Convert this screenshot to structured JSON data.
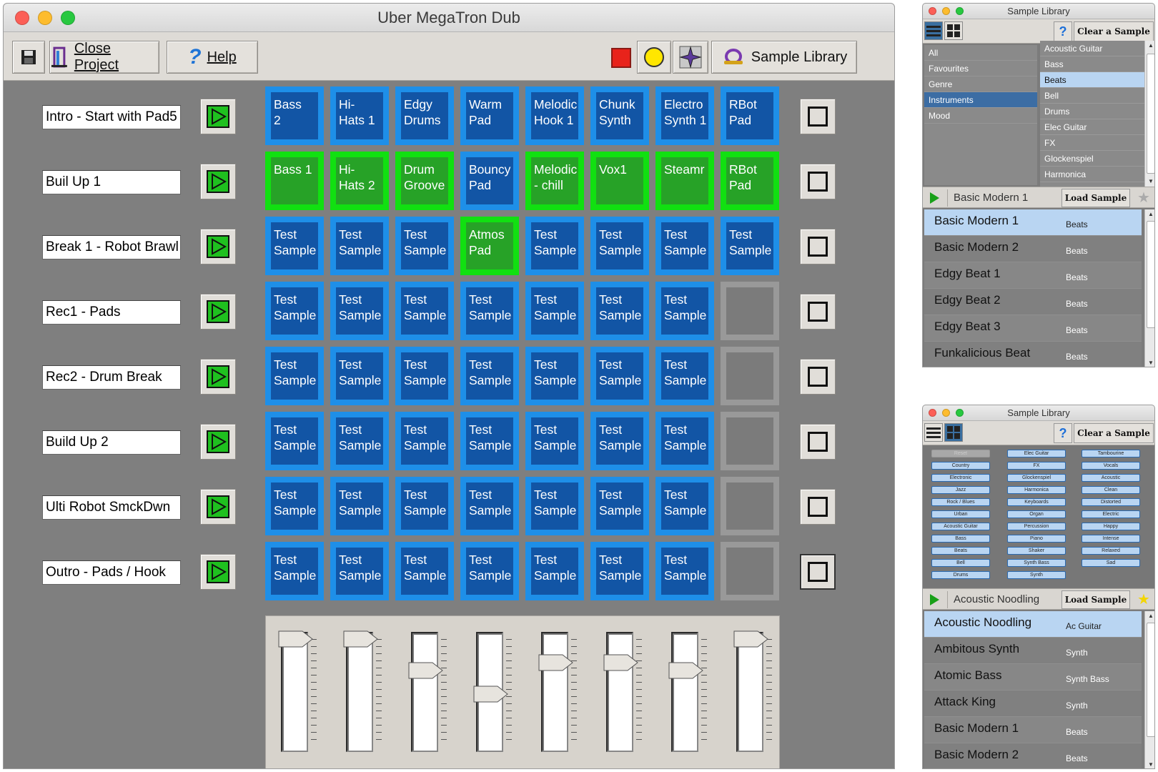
{
  "app": {
    "title": "Uber MegaTron Dub",
    "toolbar": {
      "close_project": "Close Project",
      "help": "Help",
      "sample_library": "Sample Library"
    }
  },
  "scenes": [
    {
      "name": "Intro - Start with Pad5"
    },
    {
      "name": "Buil Up 1"
    },
    {
      "name": "Break 1 - Robot Brawl"
    },
    {
      "name": "Rec1 - Pads"
    },
    {
      "name": "Rec2 - Drum Break"
    },
    {
      "name": "Build Up 2"
    },
    {
      "name": "Ulti Robot SmckDwn"
    },
    {
      "name": "Outro - Pads / Hook"
    }
  ],
  "pads": [
    [
      {
        "t": "Bass\n2",
        "s": "blue"
      },
      {
        "t": "Hi-\nHats 1",
        "s": "blue"
      },
      {
        "t": "Edgy\nDrums",
        "s": "blue"
      },
      {
        "t": "Warm\nPad",
        "s": "blue"
      },
      {
        "t": "Melodic\nHook 1",
        "s": "blue"
      },
      {
        "t": "Chunk\nSynth",
        "s": "blue"
      },
      {
        "t": "Electro\nSynth 1",
        "s": "blue"
      },
      {
        "t": "RBot\nPad",
        "s": "blue"
      }
    ],
    [
      {
        "t": "Bass 1",
        "s": "green"
      },
      {
        "t": "Hi-\nHats 2",
        "s": "green"
      },
      {
        "t": "Drum\nGroove",
        "s": "green"
      },
      {
        "t": "Bouncy\nPad",
        "s": "blue"
      },
      {
        "t": "Melodic\n- chill",
        "s": "green"
      },
      {
        "t": "Vox1",
        "s": "green"
      },
      {
        "t": "Steamr",
        "s": "green"
      },
      {
        "t": "RBot\nPad",
        "s": "green"
      }
    ],
    [
      {
        "t": "Test\nSample",
        "s": "blue"
      },
      {
        "t": "Test\nSample",
        "s": "blue"
      },
      {
        "t": "Test\nSample",
        "s": "blue"
      },
      {
        "t": "Atmos\nPad",
        "s": "green"
      },
      {
        "t": "Test\nSample",
        "s": "blue"
      },
      {
        "t": "Test\nSample",
        "s": "blue"
      },
      {
        "t": "Test\nSample",
        "s": "blue"
      },
      {
        "t": "Test\nSample",
        "s": "blue"
      }
    ],
    [
      {
        "t": "Test\nSample",
        "s": "blue"
      },
      {
        "t": "Test\nSample",
        "s": "blue"
      },
      {
        "t": "Test\nSample",
        "s": "blue"
      },
      {
        "t": "Test\nSample",
        "s": "blue"
      },
      {
        "t": "Test\nSample",
        "s": "blue"
      },
      {
        "t": "Test\nSample",
        "s": "blue"
      },
      {
        "t": "Test\nSample",
        "s": "blue"
      },
      {
        "t": "",
        "s": "empty"
      }
    ],
    [
      {
        "t": "Test\nSample",
        "s": "blue"
      },
      {
        "t": "Test\nSample",
        "s": "blue"
      },
      {
        "t": "Test\nSample",
        "s": "blue"
      },
      {
        "t": "Test\nSample",
        "s": "blue"
      },
      {
        "t": "Test\nSample",
        "s": "blue"
      },
      {
        "t": "Test\nSample",
        "s": "blue"
      },
      {
        "t": "Test\nSample",
        "s": "blue"
      },
      {
        "t": "",
        "s": "empty"
      }
    ],
    [
      {
        "t": "Test\nSample",
        "s": "blue"
      },
      {
        "t": "Test\nSample",
        "s": "blue"
      },
      {
        "t": "Test\nSample",
        "s": "blue"
      },
      {
        "t": "Test\nSample",
        "s": "blue"
      },
      {
        "t": "Test\nSample",
        "s": "blue"
      },
      {
        "t": "Test\nSample",
        "s": "blue"
      },
      {
        "t": "Test\nSample",
        "s": "blue"
      },
      {
        "t": "",
        "s": "empty"
      }
    ],
    [
      {
        "t": "Test\nSample",
        "s": "blue"
      },
      {
        "t": "Test\nSample",
        "s": "blue"
      },
      {
        "t": "Test\nSample",
        "s": "blue"
      },
      {
        "t": "Test\nSample",
        "s": "blue"
      },
      {
        "t": "Test\nSample",
        "s": "blue"
      },
      {
        "t": "Test\nSample",
        "s": "blue"
      },
      {
        "t": "Test\nSample",
        "s": "blue"
      },
      {
        "t": "",
        "s": "empty"
      }
    ],
    [
      {
        "t": "Test\nSample",
        "s": "blue"
      },
      {
        "t": "Test\nSample",
        "s": "blue"
      },
      {
        "t": "Test\nSample",
        "s": "blue"
      },
      {
        "t": "Test\nSample",
        "s": "blue"
      },
      {
        "t": "Test\nSample",
        "s": "blue"
      },
      {
        "t": "Test\nSample",
        "s": "blue"
      },
      {
        "t": "Test\nSample",
        "s": "blue"
      },
      {
        "t": "",
        "s": "empty"
      }
    ]
  ],
  "faders": {
    "levels": [
      1.0,
      1.0,
      0.7,
      0.48,
      0.78,
      0.78,
      0.7,
      1.0
    ]
  },
  "colors": {
    "pad_blue": "#1e8fe8",
    "pad_green": "#11e011",
    "stop_red": "#e8231b",
    "record_yellow": "#ffe600"
  },
  "library_list": {
    "title": "Sample Library",
    "clear_label": "Clear a Sample",
    "categories": [
      {
        "label": "All"
      },
      {
        "label": "Favourites"
      },
      {
        "label": "Genre"
      },
      {
        "label": "Instruments",
        "sel": true
      },
      {
        "label": "Mood"
      }
    ],
    "subcategories": [
      {
        "label": "Acoustic Guitar"
      },
      {
        "label": "Bass"
      },
      {
        "label": "Beats",
        "sel": true
      },
      {
        "label": "Bell"
      },
      {
        "label": "Drums"
      },
      {
        "label": "Elec Guitar"
      },
      {
        "label": "FX"
      },
      {
        "label": "Glockenspiel"
      },
      {
        "label": "Harmonica"
      }
    ],
    "current_sample": "Basic Modern 1",
    "load_label": "Load Sample",
    "samples": [
      {
        "name": "Basic Modern 1",
        "type": "Beats",
        "sel": true
      },
      {
        "name": "Basic Modern 2",
        "type": "Beats"
      },
      {
        "name": "Edgy Beat 1",
        "type": "Beats"
      },
      {
        "name": "Edgy Beat 2",
        "type": "Beats"
      },
      {
        "name": "Edgy Beat 3",
        "type": "Beats"
      },
      {
        "name": "Funkalicious Beat",
        "type": "Beats"
      }
    ]
  },
  "library_tags": {
    "title": "Sample Library",
    "clear_label": "Clear a Sample",
    "tag_columns": [
      [
        "Reset",
        "Country",
        "Electronic",
        "Jazz",
        "Rock / Blues",
        "Urban",
        "Acoustic Guitar",
        "Bass",
        "Beats",
        "Bell",
        "Drums"
      ],
      [
        "Elec Guitar",
        "FX",
        "Glockenspiel",
        "Harmonica",
        "Keyboards",
        "Organ",
        "Percussion",
        "Piano",
        "Shaker",
        "Synth Bass",
        "Synth"
      ],
      [
        "Tambourine",
        "Vocals",
        "Acoustic",
        "Clean",
        "Distorted",
        "Electric",
        "Happy",
        "Intense",
        "Relaxed",
        "Sad"
      ]
    ],
    "current_sample": "Acoustic Noodling",
    "load_label": "Load Sample",
    "samples": [
      {
        "name": "Acoustic Noodling",
        "type": "Ac Guitar",
        "sel": true
      },
      {
        "name": "Ambitous Synth",
        "type": "Synth"
      },
      {
        "name": "Atomic Bass",
        "type": "Synth Bass"
      },
      {
        "name": "Attack King",
        "type": "Synth"
      },
      {
        "name": "Basic Modern 1",
        "type": "Beats"
      },
      {
        "name": "Basic Modern 2",
        "type": "Beats"
      }
    ]
  }
}
